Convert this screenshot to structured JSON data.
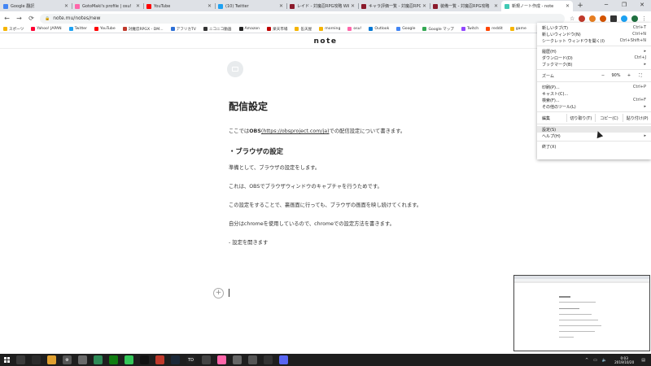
{
  "tabs": [
    {
      "title": "Google 翻訳",
      "color": "#4285f4",
      "active": false
    },
    {
      "title": "GotoMaki's profile | osu!",
      "color": "#ff66aa",
      "active": false
    },
    {
      "title": "YouTube",
      "color": "#ff0000",
      "active": false
    },
    {
      "title": "(10) Twitter",
      "color": "#1da1f2",
      "active": false
    },
    {
      "title": "レイド - 対魔忍RPG攻略 Wiki",
      "color": "#8b1a2b",
      "active": false
    },
    {
      "title": "キャラ評価一覧 - 対魔忍RPG攻",
      "color": "#8b1a2b",
      "active": false
    },
    {
      "title": "装備一覧 - 対魔忍RPG攻略",
      "color": "#8b1a2b",
      "active": false
    },
    {
      "title": "新規ノート作成 - note",
      "color": "#41c9b4",
      "active": true
    }
  ],
  "address": {
    "url": "note.mu/notes/new"
  },
  "bookmarks": [
    {
      "label": "スポーツ",
      "color": "#f5b400"
    },
    {
      "label": "Yahoo! JAPAN",
      "color": "#ff0033"
    },
    {
      "label": "Twitter",
      "color": "#1da1f2"
    },
    {
      "label": "YouTube",
      "color": "#ff0000"
    },
    {
      "label": "対魔忍RPGX - DM...",
      "color": "#c0392b"
    },
    {
      "label": "アフリカTV",
      "color": "#2c6fd6"
    },
    {
      "label": "ニコニコ動画",
      "color": "#333333"
    },
    {
      "label": "Amazon",
      "color": "#222222"
    },
    {
      "label": "楽天市場",
      "color": "#bf0000"
    },
    {
      "label": "缶天屋",
      "color": "#f5b400"
    },
    {
      "label": "morning",
      "color": "#f5b400"
    },
    {
      "label": "osu!",
      "color": "#ff66aa"
    },
    {
      "label": "Outlook",
      "color": "#0078d4"
    },
    {
      "label": "Google",
      "color": "#4285f4"
    },
    {
      "label": "Google マップ",
      "color": "#34a853"
    },
    {
      "label": "Twitch",
      "color": "#9146ff"
    },
    {
      "label": "reddit",
      "color": "#ff4500"
    },
    {
      "label": "game",
      "color": "#f5b400"
    }
  ],
  "site": {
    "logo": "note"
  },
  "article": {
    "title": "配信設定",
    "intro_pre": "ここでは",
    "intro_bold": "OBS",
    "intro_link": "(https://obsproject.com/ja)",
    "intro_post": "での配信設定について書きます。",
    "section": "・ブラウザの設定",
    "paragraphs": [
      "準備として、ブラウザの設定をします。",
      "これは、OBSでブラウザウィンドウのキャプチャを行うためです。",
      "この設定をすることで、裏画面に行っても、ブラウザの画面を映し続けてくれます。",
      "自分はchromeを使用しているので、chromeでの設定方法を書きます。",
      "- 設定を開きます"
    ]
  },
  "menu": {
    "items_top": [
      {
        "label": "新しいタブ(T)",
        "shortcut": "Ctrl+T"
      },
      {
        "label": "新しいウィンドウ(N)",
        "shortcut": "Ctrl+N"
      },
      {
        "label": "シークレット ウィンドウを開く(I)",
        "shortcut": "Ctrl+Shift+N"
      }
    ],
    "items_mid": [
      {
        "label": "履歴(H)",
        "shortcut": "▸"
      },
      {
        "label": "ダウンロード(D)",
        "shortcut": "Ctrl+J"
      },
      {
        "label": "ブックマーク(B)",
        "shortcut": "▸"
      }
    ],
    "zoom": {
      "label": "ズーム",
      "minus": "−",
      "value": "90%",
      "plus": "+",
      "full": "⛶"
    },
    "items_tools": [
      {
        "label": "印刷(P)...",
        "shortcut": "Ctrl+P"
      },
      {
        "label": "キャスト(C)...",
        "shortcut": ""
      },
      {
        "label": "検索(F)...",
        "shortcut": "Ctrl+F"
      },
      {
        "label": "その他のツール(L)",
        "shortcut": "▸"
      }
    ],
    "edit": {
      "label": "編集",
      "cut": "切り取り(T)",
      "copy": "コピー(C)",
      "paste": "貼り付け(P)"
    },
    "items_settings": [
      {
        "label": "設定(S)",
        "shortcut": ""
      },
      {
        "label": "ヘルプ(H)",
        "shortcut": "▸"
      }
    ],
    "exit": {
      "label": "終了(X)"
    }
  },
  "taskbar": {
    "time": "0:03",
    "date": "2019/10/20",
    "apps": [
      {
        "color": "#3a3a3a",
        "label": ""
      },
      {
        "color": "#2b2b2b",
        "label": ""
      },
      {
        "color": "#e0a030",
        "label": ""
      },
      {
        "color": "#555555",
        "label": "⚙"
      },
      {
        "color": "#6a6a6a",
        "label": ""
      },
      {
        "color": "#2e8b57",
        "label": ""
      },
      {
        "color": "#107c10",
        "label": ""
      },
      {
        "color": "#34c759",
        "label": ""
      },
      {
        "color": "#111111",
        "label": ""
      },
      {
        "color": "#c0392b",
        "label": ""
      },
      {
        "color": "#1b2838",
        "label": ""
      },
      {
        "color": "#222222",
        "label": "TD"
      },
      {
        "color": "#444444",
        "label": ""
      },
      {
        "color": "#ff66aa",
        "label": ""
      },
      {
        "color": "#666666",
        "label": ""
      },
      {
        "color": "#555555",
        "label": ""
      },
      {
        "color": "#333333",
        "label": ""
      },
      {
        "color": "#5865f2",
        "label": ""
      }
    ]
  }
}
